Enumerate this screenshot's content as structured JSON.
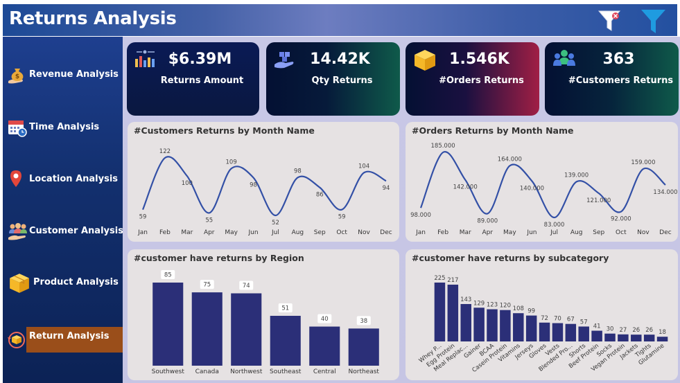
{
  "header": {
    "title": "Returns Analysis",
    "clear_filter_icon": "filter-clear-icon",
    "filter_icon": "filter-icon"
  },
  "sidebar": {
    "items": [
      {
        "label": "Revenue Analysis",
        "icon": "money-bag-icon",
        "active": false
      },
      {
        "label": "Time Analysis",
        "icon": "calendar-clock-icon",
        "active": false
      },
      {
        "label": "Location Analysis",
        "icon": "map-pin-icon",
        "active": false
      },
      {
        "label": "Customer Analysis",
        "icon": "people-icon",
        "active": false
      },
      {
        "label": "Product Analysis",
        "icon": "box-icon",
        "active": false
      },
      {
        "label": "Return Analysis",
        "icon": "return-box-icon",
        "active": true
      }
    ]
  },
  "kpis": [
    {
      "value": "$6.39M",
      "label": "Returns Amount",
      "icon": "bar-chart-icon"
    },
    {
      "value": "14.42K",
      "label": "Qty Returns",
      "icon": "hand-boxes-icon"
    },
    {
      "value": "1.546K",
      "label": "#Orders Returns",
      "icon": "box-icon"
    },
    {
      "value": "363",
      "label": "#Customers Returns",
      "icon": "customers-icon"
    }
  ],
  "colors": {
    "line": "#3350a6",
    "bar": "#2b2f78",
    "active_nav": "#9a4e1a",
    "panel_bg": "#e6e2e3"
  },
  "chart_data": [
    {
      "type": "line",
      "title": "#Customers Returns by Month Name",
      "categories": [
        "Jan",
        "Feb",
        "Mar",
        "Apr",
        "May",
        "Jun",
        "Jul",
        "Aug",
        "Sep",
        "Oct",
        "Nov",
        "Dec"
      ],
      "values": [
        59,
        122,
        100,
        55,
        109,
        98,
        52,
        98,
        86,
        59,
        104,
        94
      ],
      "labels": [
        "59",
        "122",
        "100",
        "55",
        "109",
        "98",
        "52",
        "98",
        "86",
        "59",
        "104",
        "94"
      ],
      "ylim": [
        52,
        122
      ]
    },
    {
      "type": "line",
      "title": "#Orders Returns by Month Name",
      "categories": [
        "Jan",
        "Feb",
        "Mar",
        "Apr",
        "May",
        "Jun",
        "Jul",
        "Aug",
        "Sep",
        "Oct",
        "Nov",
        "Dec"
      ],
      "values": [
        98,
        185,
        142,
        89,
        164,
        140,
        83,
        139,
        121,
        92,
        159,
        134
      ],
      "labels": [
        "98.000",
        "185.000",
        "142.000",
        "89.000",
        "164.000",
        "140.000",
        "83.000",
        "139.000",
        "121.000",
        "92.000",
        "159.000",
        "134.000"
      ],
      "ylim": [
        83,
        185
      ]
    },
    {
      "type": "bar",
      "title": "#customer have returns by Region",
      "categories": [
        "Southwest",
        "Canada",
        "Northwest",
        "Southeast",
        "Central",
        "Northeast"
      ],
      "values": [
        85,
        75,
        74,
        51,
        40,
        38
      ],
      "ylim": [
        0,
        85
      ]
    },
    {
      "type": "bar",
      "title": "#customer have returns by subcategory",
      "categories": [
        "Whey P...",
        "Egg Protein",
        "Meal Replac...",
        "Gainer",
        "BCAA",
        "Casein Protein",
        "Vitamins",
        "Jerseys",
        "Gloves",
        "Vests",
        "Blended Pro...",
        "Shorts",
        "Beef Protein",
        "Socks",
        "Vegan Protein",
        "Jackets",
        "Tights",
        "Glutamine"
      ],
      "values": [
        225,
        217,
        143,
        129,
        123,
        120,
        108,
        99,
        72,
        70,
        67,
        57,
        41,
        30,
        27,
        26,
        26,
        18
      ],
      "ylim": [
        0,
        225
      ]
    }
  ]
}
